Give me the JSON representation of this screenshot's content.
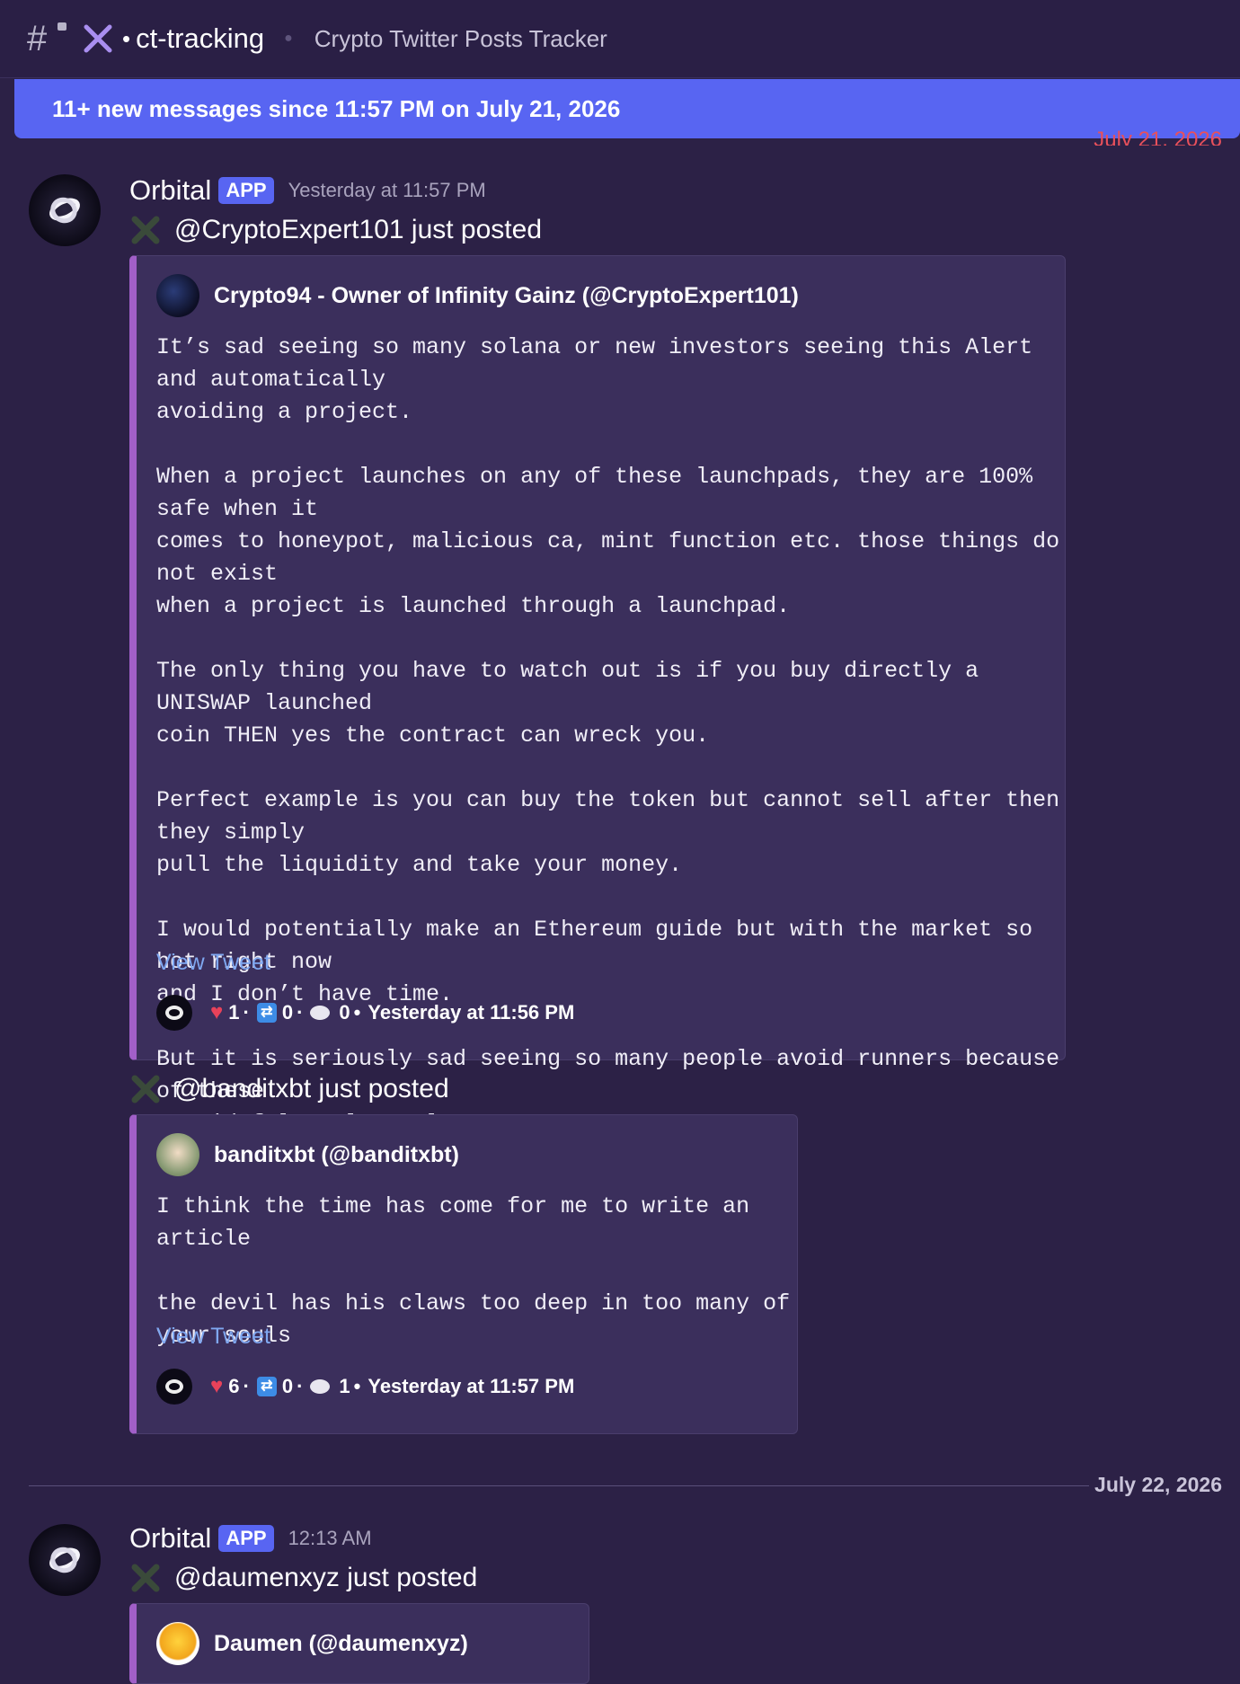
{
  "topbar": {
    "channel": "ct-tracking",
    "dot": "•",
    "topic": "Crypto Twitter Posts Tracker",
    "icons": [
      "private-channel-icon",
      "x-logo-icon"
    ]
  },
  "new_messages_bar": "11+ new messages since 11:57 PM on July 21, 2026",
  "ghost_date": "July 21, 2026",
  "messages": [
    {
      "username": "Orbital",
      "tag": "APP",
      "timestamp": "Yesterday at 11:57 PM",
      "posts": [
        {
          "posted_line": "@CryptoExpert101 just posted",
          "author": "Crypto94 - Owner of Infinity Gainz (@CryptoExpert101)",
          "body": "It’s sad seeing so many solana or new investors seeing this Alert and automatically\navoiding a project.\n\nWhen a project launches on any of these launchpads, they are 100% safe when it\ncomes to honeypot, malicious ca, mint function etc. those things do not exist\nwhen a project is launched through a launchpad.\n\nThe only thing you have to watch out is if you buy directly a UNISWAP launched\ncoin THEN yes the contract can wreck you.\n\nPerfect example is you can buy the token but cannot sell after then they simply\npull the liquidity and take your money.\n\nI would potentially make an Ethereum guide but with the market so hot right now\nand I don’t have time.\n\nBut it is seriously sad seeing so many people avoid runners because of these\nstupid false alarm alerts",
          "view_link": "View Tweet",
          "likes": "1",
          "retweets": "0",
          "replies": "0",
          "time": "Yesterday at 11:56 PM"
        },
        {
          "posted_line": "@banditxbt just posted",
          "author": "banditxbt (@banditxbt)",
          "body": "I think the time has come for me to write an article\n\nthe devil has his claws too deep in too many of your souls",
          "view_link": "View Tweet",
          "likes": "6",
          "retweets": "0",
          "replies": "1",
          "time": "Yesterday at 11:57 PM"
        }
      ]
    },
    {
      "username": "Orbital",
      "tag": "APP",
      "timestamp": "12:13 AM",
      "posts": [
        {
          "posted_line": "@daumenxyz just posted",
          "author": "Daumen (@daumenxyz)"
        }
      ]
    }
  ],
  "date_divider": "July 22, 2026",
  "separators": {
    "dot": "·",
    "bullet": "•"
  },
  "colors": {
    "background": "#2c2146",
    "embed": "#3b2f5c",
    "embed_accent": "#a15fc8",
    "banner": "#5865f2",
    "link": "#7fa7f0"
  }
}
